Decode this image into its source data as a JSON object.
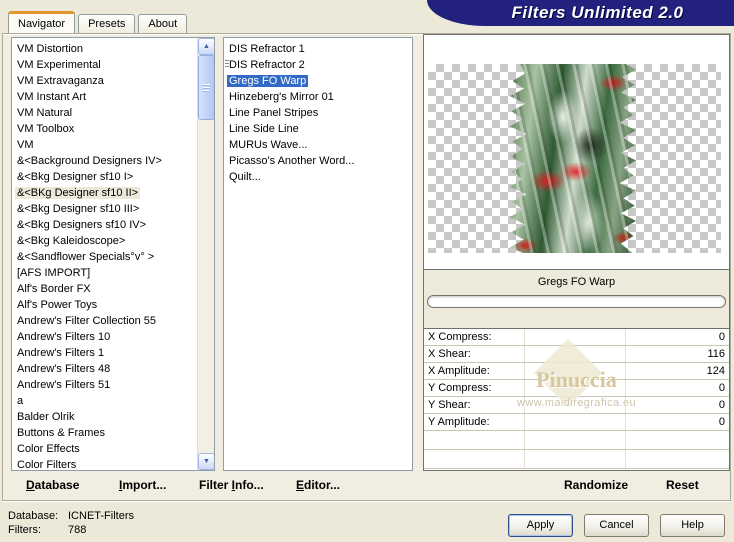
{
  "window": {
    "title": "Filters Unlimited 2.0"
  },
  "colors": {
    "banner": "#22227E",
    "selection_blue": "#316AC5",
    "category_selection": "#ECE9D8",
    "tab_highlight": "#E5952E"
  },
  "tabs": {
    "items": [
      "Navigator",
      "Presets",
      "About"
    ],
    "selected_index": 0
  },
  "category_list": {
    "items": [
      "VM Distortion",
      "VM Experimental",
      "VM Extravaganza",
      "VM Instant Art",
      "VM Natural",
      "VM Toolbox",
      "VM",
      "&<Background Designers IV>",
      "&<Bkg Designer sf10 I>",
      "&<BKg Designer sf10 II>",
      "&<Bkg Designer sf10 III>",
      "&<Bkg Designers sf10 IV>",
      "&<Bkg Kaleidoscope>",
      "&<Sandflower Specials°v° >",
      "[AFS IMPORT]",
      "Alf's Border FX",
      "Alf's Power Toys",
      "Andrew's Filter Collection 55",
      "Andrew's Filters 10",
      "Andrew's Filters 1",
      "Andrew's Filters 48",
      "Andrew's Filters 51",
      "a",
      "Balder Olrik",
      "Buttons & Frames",
      "Color Effects",
      "Color Filters"
    ],
    "selected_index": 9
  },
  "filter_list": {
    "items": [
      "DIS Refractor 1",
      "DIS Refractor 2",
      "Gregs FO Warp",
      "Hinzeberg's Mirror 01",
      "Line Panel Stripes",
      "Line Side Line",
      "MURUs Wave...",
      "Picasso's Another Word...",
      "Quilt..."
    ],
    "selected_index": 2
  },
  "filter_panel": {
    "name": "Gregs FO Warp",
    "params": [
      {
        "label": "X Compress:",
        "value": "0"
      },
      {
        "label": "X Shear:",
        "value": "116"
      },
      {
        "label": "X Amplitude:",
        "value": "124"
      },
      {
        "label": "Y Compress:",
        "value": "0"
      },
      {
        "label": "Y Shear:",
        "value": "0"
      },
      {
        "label": "Y Amplitude:",
        "value": "0"
      }
    ]
  },
  "toolbar": {
    "items": [
      {
        "pre": "",
        "u": "D",
        "post": "atabase"
      },
      {
        "pre": "",
        "u": "I",
        "post": "mport..."
      },
      {
        "pre": "Filter ",
        "u": "I",
        "post": "nfo..."
      },
      {
        "pre": "",
        "u": "E",
        "post": "ditor..."
      }
    ],
    "randomize": "Randomize",
    "reset": "Reset"
  },
  "watermark": {
    "name": "Pinuccia",
    "site": "www.maidiregrafica.eu"
  },
  "status": {
    "database_label": "Database:",
    "database_value": "ICNET-Filters",
    "filters_label": "Filters:",
    "filters_value": "788"
  },
  "buttons": {
    "apply": "Apply",
    "cancel": "Cancel",
    "help": "Help"
  },
  "icons": {
    "scroll_up": "▲",
    "scroll_down": "▼"
  }
}
